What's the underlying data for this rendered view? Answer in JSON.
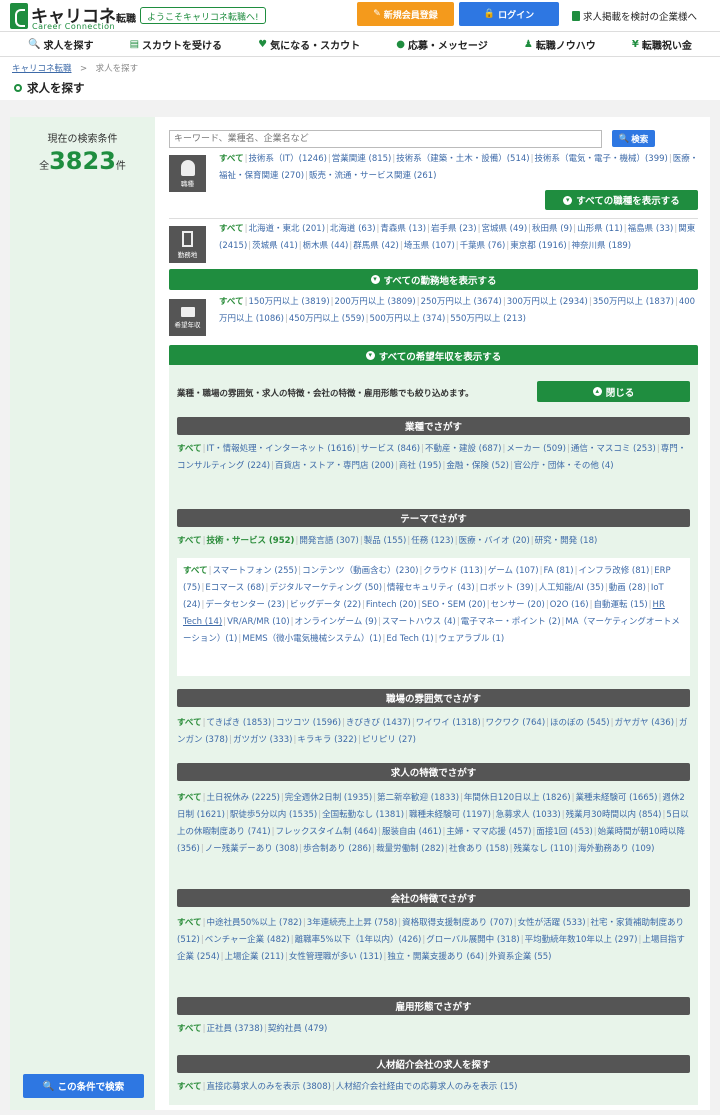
{
  "header": {
    "logo_main": "キャリコネ",
    "logo_small": "転職",
    "logo_sub": "Career Connection",
    "welcome": "ようこそキャリコネ転職へ!",
    "register": "新規会員登録",
    "login": "ログイン",
    "employer": "求人掲載を検討の企業様へ"
  },
  "nav": [
    {
      "label": "求人を探す",
      "icon": "search-icon"
    },
    {
      "label": "スカウトを受ける",
      "icon": "scout-icon"
    },
    {
      "label": "気になる・スカウト",
      "icon": "heart-icon"
    },
    {
      "label": "応募・メッセージ",
      "icon": "chat-icon"
    },
    {
      "label": "転職ノウハウ",
      "icon": "person-icon"
    },
    {
      "label": "転職祝い金",
      "icon": "yen-icon"
    }
  ],
  "breadcrumb": {
    "home": "キャリコネ転職",
    "sep": ">",
    "current": "求人を探す"
  },
  "page_title": "求人を探す",
  "left": {
    "count_label": "現在の検索条件",
    "count_prefix": "全",
    "count": "3823",
    "count_suffix": "件",
    "search_btn": "この条件で検索"
  },
  "search": {
    "placeholder": "キーワード、業種名、企業名など",
    "button": "検索"
  },
  "job": {
    "label": "職種",
    "items": [
      "すべて",
      "技術系（IT）(1246)",
      "営業関連 (815)",
      "技術系（建築・土木・設備）(514)",
      "技術系（電気・電子・機械）(399)",
      "医療・福祉・保育関連 (270)",
      "販売・流通・サービス関連 (261)"
    ],
    "all_btn": "すべての職種を表示する"
  },
  "location": {
    "label": "勤務地",
    "items": [
      "すべて",
      "北海道・東北 (201)",
      "北海道 (63)",
      "青森県 (13)",
      "岩手県 (23)",
      "宮城県 (49)",
      "秋田県 (9)",
      "山形県 (11)",
      "福島県 (33)",
      "関東 (2415)",
      "茨城県 (41)",
      "栃木県 (44)",
      "群馬県 (42)",
      "埼玉県 (107)",
      "千葉県 (76)",
      "東京都 (1916)",
      "神奈川県 (189)"
    ],
    "all_btn": "すべての勤務地を表示する"
  },
  "salary": {
    "label": "希望年収",
    "items": [
      "すべて",
      "150万円以上 (3819)",
      "200万円以上 (3809)",
      "250万円以上 (3674)",
      "300万円以上 (2934)",
      "350万円以上 (1837)",
      "400万円以上 (1086)",
      "450万円以上 (559)",
      "500万円以上 (374)",
      "550万円以上 (213)"
    ],
    "all_btn": "すべての希望年収を表示する"
  },
  "advanced": {
    "note": "業種・職場の雰囲気・求人の特徴・会社の特徴・雇用形態でも絞り込めます。",
    "close_btn": "閉じる",
    "industry": {
      "title": "業種でさがす",
      "items": [
        "すべて",
        "IT・情報処理・インターネット (1616)",
        "サービス (846)",
        "不動産・建設 (687)",
        "メーカー (509)",
        "通信・マスコミ (253)",
        "専門・コンサルティング (224)",
        "百貨店・ストア・専門店 (200)",
        "商社 (195)",
        "金融・保険 (52)",
        "官公庁・団体・その他 (4)"
      ]
    },
    "theme": {
      "title": "テーマでさがす",
      "tabs": [
        "すべて",
        "技術・サービス (952)",
        "開発言語 (307)",
        "製品 (155)",
        "任務 (123)",
        "医療・バイオ (20)",
        "研究・開発 (18)"
      ],
      "items": [
        "すべて",
        "スマートフォン (255)",
        "コンテンツ（動画含む）(230)",
        "クラウド (113)",
        "ゲーム (107)",
        "FA (81)",
        "インフラ改修 (81)",
        "ERP (75)",
        "Eコマース (68)",
        "デジタルマーケティング (50)",
        "情報セキュリティ (43)",
        "ロボット (39)",
        "人工知能/AI (35)",
        "動画 (28)",
        "IoT (24)",
        "データセンター (23)",
        "ビッグデータ (22)",
        "Fintech (20)",
        "SEO・SEM (20)",
        "センサー (20)",
        "O2O (16)",
        "自動運転 (15)",
        "HR Tech (14)",
        "VR/AR/MR (10)",
        "オンラインゲーム (9)",
        "スマートハウス (4)",
        "電子マネー・ポイント (2)",
        "MA（マーケティングオートメーション）(1)",
        "MEMS（微小電気機械システム）(1)",
        "Ed Tech (1)",
        "ウェアラブル (1)"
      ]
    },
    "atmosphere": {
      "title": "職場の雰囲気でさがす",
      "items": [
        "すべて",
        "てきぱき (1853)",
        "コツコツ (1596)",
        "きびきび (1437)",
        "ワイワイ (1318)",
        "ワクワク (764)",
        "ほのぼの (545)",
        "ガヤガヤ (436)",
        "ガンガン (378)",
        "ガツガツ (333)",
        "キラキラ (322)",
        "ピリピリ (27)"
      ]
    },
    "features": {
      "title": "求人の特徴でさがす",
      "items": [
        "すべて",
        "土日祝休み (2225)",
        "完全週休2日制 (1935)",
        "第二新卒歓迎 (1833)",
        "年間休日120日以上 (1826)",
        "業種未経験可 (1665)",
        "週休2日制 (1621)",
        "駅徒歩5分以内 (1535)",
        "全国転勤なし (1381)",
        "職種未経験可 (1197)",
        "急募求人 (1033)",
        "残業月30時間以内 (854)",
        "5日以上の休暇制度あり (741)",
        "フレックスタイム制 (464)",
        "服装自由 (461)",
        "主婦・ママ応援 (457)",
        "面接1回 (453)",
        "始業時間が朝10時以降 (356)",
        "ノー残業デーあり (308)",
        "歩合制あり (286)",
        "裁量労働制 (282)",
        "社食あり (158)",
        "残業なし (110)",
        "海外勤務あり (109)"
      ]
    },
    "company": {
      "title": "会社の特徴でさがす",
      "items": [
        "すべて",
        "中途社員50%以上 (782)",
        "3年連続売上上昇 (758)",
        "資格取得支援制度あり (707)",
        "女性が活躍 (533)",
        "社宅・家賃補助制度あり (512)",
        "ベンチャー企業 (482)",
        "離職率5%以下（1年以内）(426)",
        "グローバル展開中 (318)",
        "平均勤続年数10年以上 (297)",
        "上場目指す企業 (254)",
        "上場企業 (211)",
        "女性管理職が多い (131)",
        "独立・開業支援あり (64)",
        "外資系企業 (55)"
      ]
    },
    "employment": {
      "title": "雇用形態でさがす",
      "items": [
        "すべて",
        "正社員 (3738)",
        "契約社員 (479)"
      ]
    },
    "agency": {
      "title": "人材紹介会社の求人を探す",
      "items": [
        "すべて",
        "直接応募求人のみを表示 (3808)",
        "人材紹介会社経由での応募求人のみを表示 (15)"
      ]
    }
  }
}
